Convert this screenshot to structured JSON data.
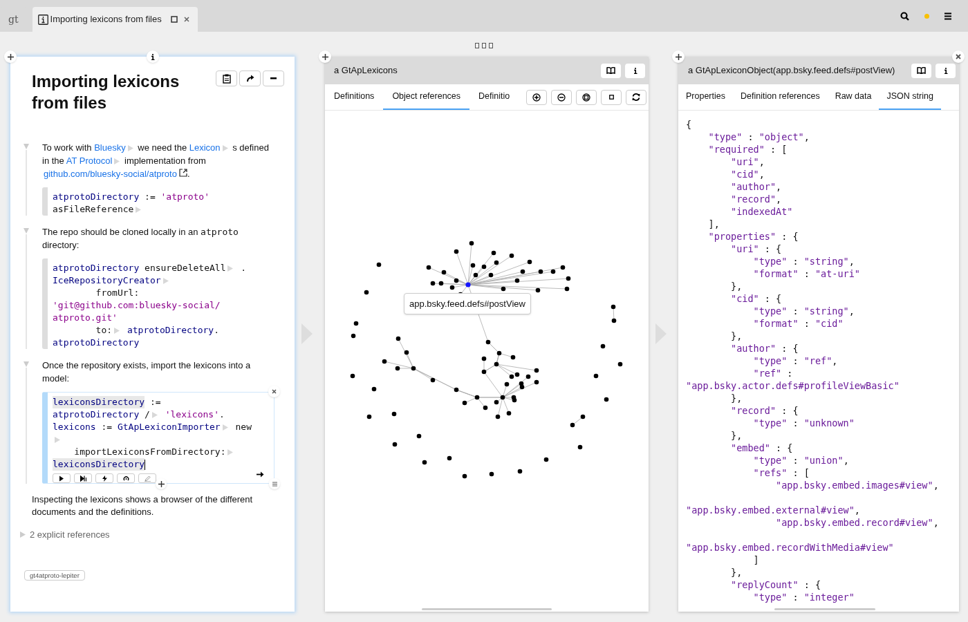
{
  "tabs": [
    {
      "label": "gt",
      "kind": "logo",
      "selected": false
    },
    {
      "label": "Importing lexicons from files",
      "kind": "page",
      "selected": true
    }
  ],
  "page": {
    "title": "Importing lexicons from files",
    "sections": [
      {
        "expanded": true,
        "paragraph": [
          {
            "kind": "text",
            "text": "To work with "
          },
          {
            "kind": "link",
            "text": "Bluesky"
          },
          {
            "kind": "expander"
          },
          {
            "kind": "text",
            "text": " we need the "
          },
          {
            "kind": "link",
            "text": "Lexicon"
          },
          {
            "kind": "expander"
          },
          {
            "kind": "text",
            "text": " s defined in the "
          },
          {
            "kind": "link",
            "text": "AT Protocol"
          },
          {
            "kind": "expander"
          },
          {
            "kind": "text",
            "text": " implementation from "
          },
          {
            "kind": "url",
            "text": "github.com/bluesky-social/atproto"
          },
          {
            "kind": "text",
            "text": "."
          }
        ],
        "code": {
          "focused": false,
          "lines": [
            [
              {
                "kind": "var",
                "text": "atprotoDirectory"
              },
              {
                "kind": "plain",
                "text": " := "
              },
              {
                "kind": "str",
                "text": "'atproto'"
              }
            ],
            [
              {
                "kind": "plain",
                "text": "asFileReference"
              },
              {
                "kind": "expander"
              }
            ]
          ]
        }
      },
      {
        "expanded": true,
        "paragraph": [
          {
            "kind": "text",
            "text": "The repo should be cloned locally in an "
          },
          {
            "kind": "code",
            "text": "atproto"
          },
          {
            "kind": "text",
            "text": " directory:"
          }
        ],
        "code": {
          "focused": false,
          "lines": [
            [
              {
                "kind": "var",
                "text": "atprotoDirectory"
              },
              {
                "kind": "plain",
                "text": " ensureDeleteAll"
              },
              {
                "kind": "expander"
              },
              {
                "kind": "plain",
                "text": " ."
              }
            ],
            [
              {
                "kind": "var",
                "text": "IceRepositoryCreator"
              },
              {
                "kind": "expander"
              }
            ],
            [
              {
                "kind": "plain",
                "text": "        fromUrl:"
              }
            ],
            [
              {
                "kind": "str",
                "text": "'git@github.com:bluesky-social/"
              }
            ],
            [
              {
                "kind": "str",
                "text": "atproto.git'"
              }
            ],
            [
              {
                "kind": "plain",
                "text": "        to:"
              },
              {
                "kind": "expander"
              },
              {
                "kind": "var",
                "text": " atprotoDirectory"
              },
              {
                "kind": "plain",
                "text": "."
              }
            ],
            [
              {
                "kind": "var",
                "text": "atprotoDirectory"
              }
            ]
          ]
        }
      },
      {
        "expanded": true,
        "paragraph": [
          {
            "kind": "text",
            "text": "Once the repository exists, import the lexicons into a model:"
          }
        ],
        "code": {
          "focused": true,
          "lines": [
            [
              {
                "kind": "match",
                "text": "lexiconsDirectory"
              },
              {
                "kind": "plain",
                "text": " :="
              }
            ],
            [
              {
                "kind": "var",
                "text": "atprotoDirectory"
              },
              {
                "kind": "plain",
                "text": " /"
              },
              {
                "kind": "expander"
              },
              {
                "kind": "str",
                "text": " 'lexicons'"
              },
              {
                "kind": "plain",
                "text": "."
              }
            ],
            [
              {
                "kind": "var",
                "text": "lexicons"
              },
              {
                "kind": "plain",
                "text": " := "
              },
              {
                "kind": "var",
                "text": "GtApLexiconImporter"
              },
              {
                "kind": "expander"
              },
              {
                "kind": "plain",
                "text": " new"
              }
            ],
            [
              {
                "kind": "expander"
              }
            ],
            [
              {
                "kind": "plain",
                "text": "    importLexiconsFromDirectory:"
              },
              {
                "kind": "expander"
              }
            ],
            [
              {
                "kind": "match",
                "text": "lexiconsDirectory"
              },
              {
                "kind": "cursor"
              }
            ]
          ]
        }
      }
    ],
    "closing_paragraph": "Inspecting the lexicons shows a browser of the different documents and the definitions.",
    "references": {
      "label": "2 explicit references",
      "expanded": false
    },
    "tag": "gt4atproto-lepiter"
  },
  "graph_panel": {
    "title": "a GtApLexicons",
    "tabs": [
      {
        "label": "Definitions",
        "selected": false
      },
      {
        "label": "Object references",
        "selected": true
      },
      {
        "label": "Definitio",
        "selected": false
      }
    ],
    "tooltip": "app.bsky.feed.defs#postView"
  },
  "json_panel": {
    "title": "a GtApLexiconObject(app.bsky.feed.defs#postView)",
    "tabs": [
      {
        "label": "Properties",
        "selected": false
      },
      {
        "label": "Definition references",
        "selected": false
      },
      {
        "label": "Raw data",
        "selected": false
      },
      {
        "label": "JSON string",
        "selected": true
      }
    ],
    "lines": [
      {
        "kind": "line",
        "text": "{"
      },
      {
        "kind": "line",
        "text": "    \"type\" : \"object\","
      },
      {
        "kind": "line",
        "text": "    \"required\" : ["
      },
      {
        "kind": "line",
        "text": "        \"uri\","
      },
      {
        "kind": "line",
        "text": "        \"cid\","
      },
      {
        "kind": "line",
        "text": "        \"author\","
      },
      {
        "kind": "line",
        "text": "        \"record\","
      },
      {
        "kind": "line",
        "text": "        \"indexedAt\""
      },
      {
        "kind": "line",
        "text": "    ],"
      },
      {
        "kind": "line",
        "text": "    \"properties\" : {"
      },
      {
        "kind": "line",
        "text": "        \"uri\" : {"
      },
      {
        "kind": "line",
        "text": "            \"type\" : \"string\","
      },
      {
        "kind": "line",
        "text": "            \"format\" : \"at-uri\""
      },
      {
        "kind": "line",
        "text": "        },"
      },
      {
        "kind": "line",
        "text": "        \"cid\" : {"
      },
      {
        "kind": "line",
        "text": "            \"type\" : \"string\","
      },
      {
        "kind": "line",
        "text": "            \"format\" : \"cid\""
      },
      {
        "kind": "line",
        "text": "        },"
      },
      {
        "kind": "line",
        "text": "        \"author\" : {"
      },
      {
        "kind": "line",
        "text": "            \"type\" : \"ref\","
      },
      {
        "kind": "line",
        "text": "            \"ref\" :"
      },
      {
        "kind": "line",
        "text": "\"app.bsky.actor.defs#profileViewBasic\""
      },
      {
        "kind": "line",
        "text": "        },"
      },
      {
        "kind": "line",
        "text": "        \"record\" : {"
      },
      {
        "kind": "line",
        "text": "            \"type\" : \"unknown\""
      },
      {
        "kind": "line",
        "text": "        },"
      },
      {
        "kind": "line",
        "text": "        \"embed\" : {"
      },
      {
        "kind": "line",
        "text": "            \"type\" : \"union\","
      },
      {
        "kind": "line",
        "text": "            \"refs\" : ["
      },
      {
        "kind": "line",
        "text": "                \"app.bsky.embed.images#view\","
      },
      {
        "kind": "blank"
      },
      {
        "kind": "line",
        "text": "\"app.bsky.embed.external#view\","
      },
      {
        "kind": "line",
        "text": "                \"app.bsky.embed.record#view\","
      },
      {
        "kind": "blank"
      },
      {
        "kind": "line",
        "text": "\"app.bsky.embed.recordWithMedia#view\""
      },
      {
        "kind": "line",
        "text": "            ]"
      },
      {
        "kind": "line",
        "text": "        },"
      },
      {
        "kind": "line",
        "text": "        \"replyCount\" : {"
      },
      {
        "kind": "line",
        "text": "            \"type\" : \"integer\""
      }
    ]
  }
}
